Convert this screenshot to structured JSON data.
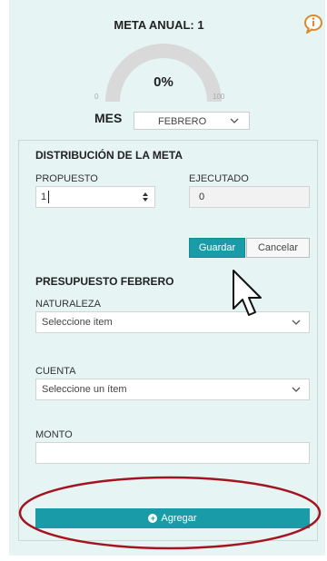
{
  "header": {
    "title": "META ANUAL: 1"
  },
  "gauge": {
    "value": "0%",
    "min": "0",
    "max": "100",
    "percent": 0
  },
  "mes": {
    "label": "MES",
    "selected": "FEBRERO"
  },
  "distribucion": {
    "title": "DISTRIBUCIÓN DE LA META",
    "propuesto_label": "PROPUESTO",
    "propuesto_value": "1",
    "ejecutado_label": "EJECUTADO",
    "ejecutado_value": "0",
    "guardar": "Guardar",
    "cancelar": "Cancelar"
  },
  "presupuesto": {
    "title": "PRESUPUESTO FEBRERO",
    "naturaleza_label": "NATURALEZA",
    "naturaleza_value": "Seleccione item",
    "cuenta_label": "CUENTA",
    "cuenta_value": "Seleccione un ítem",
    "monto_label": "MONTO",
    "monto_value": ""
  },
  "agregar": {
    "label": "Agregar",
    "icon": "plus-circle-icon"
  },
  "colors": {
    "accent": "#1a9ca8",
    "panel": "#e6f4f4",
    "annotation": "#a31420",
    "info": "#d98a2b"
  },
  "icons": {
    "info": "info-icon",
    "chevron": "chevron-down-icon",
    "spinner": "spinner-arrows-icon",
    "cursor": "mouse-pointer-icon"
  }
}
